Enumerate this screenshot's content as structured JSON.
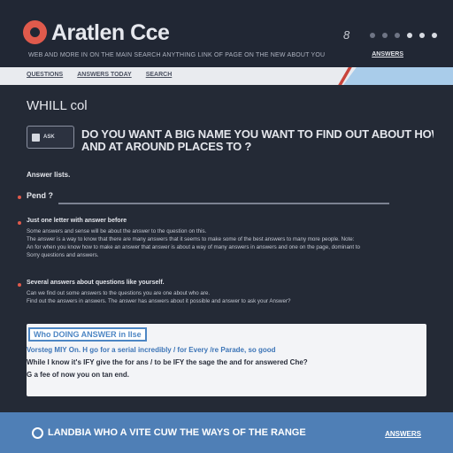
{
  "header": {
    "logo_text": "Aratlen Cce",
    "tagline": "WEB AND MORE IN ON THE MAIN SEARCH ANYTHING LINK OF PAGE ON THE NEW ABOUT YOU",
    "link": "ANSWERS",
    "icons": [
      "user-icon",
      "dot-icon",
      "dot-icon",
      "dot-icon",
      "dot-icon",
      "dot-icon",
      "dot-icon"
    ]
  },
  "nav": {
    "items": [
      "QUESTIONS",
      "ANSWERS TODAY",
      "SEARCH"
    ]
  },
  "main": {
    "title": "WHILL col",
    "search_button_label": "ASK",
    "question_line1": "DO YOU WANT A BIG NAME YOU WANT TO FIND OUT ABOUT HOW TO ASK A QUESTION?",
    "question_line2": "AND AT AROUND PLACES TO ?",
    "section_head": "Answer lists.",
    "field_label": "Pend ?",
    "bullets": [
      {
        "title": "Just one letter with answer before",
        "lines": [
          "Some answers and sense will be about the answer to the question on this.",
          "The answer is a way to know that there are many answers that it seems to make some of the best answers to many more people. Note:",
          "An for when you know how to make an answer that answer is about a way of many answers in answers and one on the page, dominant to",
          "Sorry questions and answers."
        ]
      },
      {
        "title": "Several answers about questions like yourself.",
        "lines": [
          "Can we find out some answers to the questions you are one about who are.",
          "Find out the answers in answers. The answer has answers about it possible and answer to ask your Answer?"
        ]
      }
    ]
  },
  "card": {
    "tab_label": "Who DOING ANSWER in Ilse",
    "line1": "Vorsteg MIY On. H go for a serial incredibly / for Every /re Parade, so good",
    "line2": "While I know it's IFY give the for ans / to be IFY the sage the and for answered Che?",
    "line3": "G a fee of now you on tan end."
  },
  "footer": {
    "text": "LANDBIA WHO A VITE CUW THE WAYS OF THE RANGE",
    "link": "ANSWERS"
  },
  "colors": {
    "background": "#242a36",
    "accent_red": "#e05a4c",
    "accent_blue": "#4f7fb6",
    "nav_bg": "#e9ebef",
    "card_bg": "#f3f4f7"
  }
}
